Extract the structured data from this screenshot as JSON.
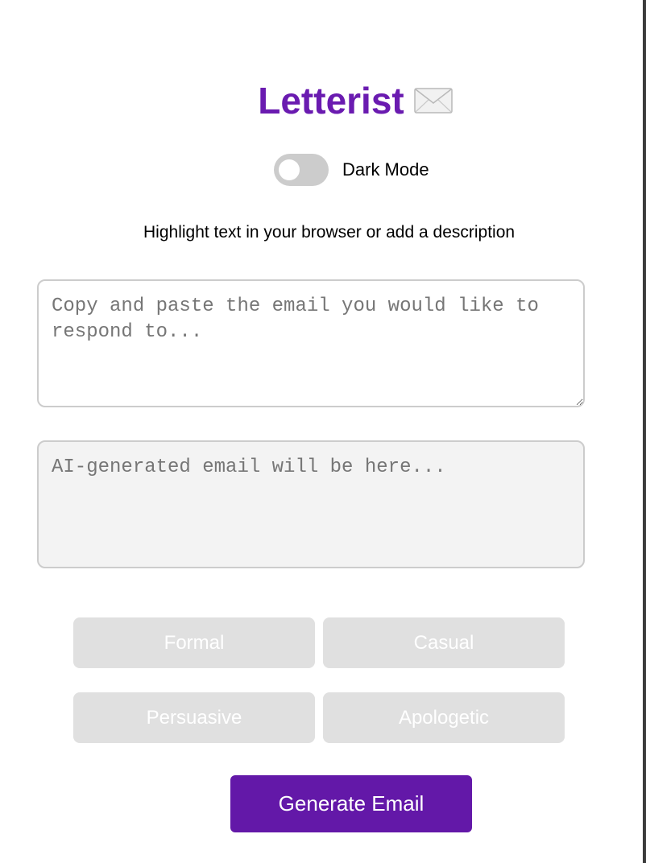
{
  "app": {
    "title": "Letterist",
    "title_icon": "envelope-icon",
    "accent_color": "#6a1bb0"
  },
  "dark_mode": {
    "label": "Dark Mode",
    "enabled": false
  },
  "hint": "Highlight text in your browser or add a description",
  "input": {
    "placeholder": "Copy and paste the email you would like to respond to...",
    "value": ""
  },
  "output": {
    "placeholder": "AI-generated email will be here...",
    "value": ""
  },
  "tones": {
    "formal": "Formal",
    "casual": "Casual",
    "persuasive": "Persuasive",
    "apologetic": "Apologetic"
  },
  "generate": {
    "label": "Generate Email",
    "color": "#6318a8"
  }
}
